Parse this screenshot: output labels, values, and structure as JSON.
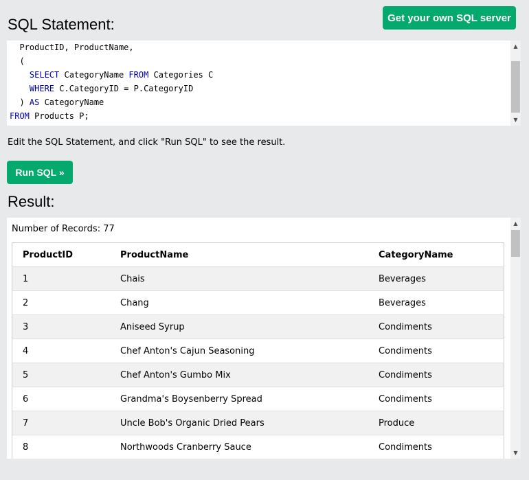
{
  "header": {
    "sql_heading": "SQL Statement:",
    "server_button": "Get your own SQL server"
  },
  "editor": {
    "lines": [
      [
        {
          "t": "  ProductID, ProductName,",
          "k": false
        }
      ],
      [
        {
          "t": "  (",
          "k": false
        }
      ],
      [
        {
          "t": "    ",
          "k": false
        },
        {
          "t": "SELECT",
          "k": true
        },
        {
          "t": " CategoryName ",
          "k": false
        },
        {
          "t": "FROM",
          "k": true
        },
        {
          "t": " Categories C",
          "k": false
        }
      ],
      [
        {
          "t": "    ",
          "k": false
        },
        {
          "t": "WHERE",
          "k": true
        },
        {
          "t": " C.CategoryID = P.CategoryID",
          "k": false
        }
      ],
      [
        {
          "t": "  ) ",
          "k": false
        },
        {
          "t": "AS",
          "k": true
        },
        {
          "t": " CategoryName",
          "k": false
        }
      ],
      [
        {
          "t": "FROM",
          "k": true
        },
        {
          "t": " Products P;",
          "k": false
        }
      ]
    ]
  },
  "instruction": "Edit the SQL Statement, and click \"Run SQL\" to see the result.",
  "run_button": "Run SQL »",
  "result": {
    "heading": "Result:",
    "record_count": "Number of Records: 77",
    "columns": [
      "ProductID",
      "ProductName",
      "CategoryName"
    ],
    "rows": [
      [
        "1",
        "Chais",
        "Beverages"
      ],
      [
        "2",
        "Chang",
        "Beverages"
      ],
      [
        "3",
        "Aniseed Syrup",
        "Condiments"
      ],
      [
        "4",
        "Chef Anton's Cajun Seasoning",
        "Condiments"
      ],
      [
        "5",
        "Chef Anton's Gumbo Mix",
        "Condiments"
      ],
      [
        "6",
        "Grandma's Boysenberry Spread",
        "Condiments"
      ],
      [
        "7",
        "Uncle Bob's Organic Dried Pears",
        "Produce"
      ],
      [
        "8",
        "Northwoods Cranberry Sauce",
        "Condiments"
      ]
    ]
  },
  "icons": {
    "scroll_up": "▲",
    "scroll_down": "▼"
  },
  "colors": {
    "accent": "#04aa6d",
    "keyword": "#0000aa",
    "background": "#e7e9eb"
  }
}
